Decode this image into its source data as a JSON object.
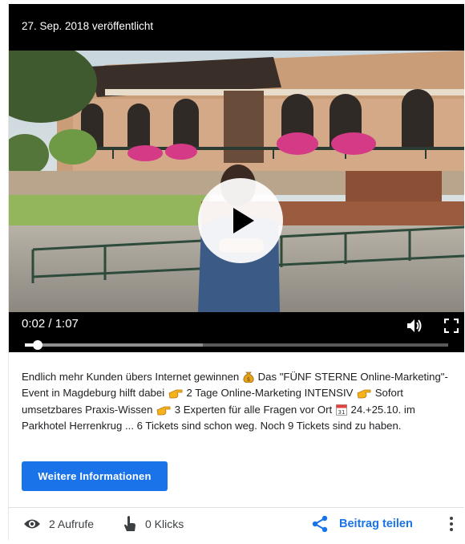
{
  "post": {
    "published_date": "27. Sep. 2018 veröffentlicht",
    "description_parts": {
      "p1": "Endlich mehr Kunden übers Internet gewinnen",
      "p2": "Das \"FÜNF STERNE Online-Marketing\"-Event in Magdeburg hilft dabei",
      "p3": "2 Tage Online-Marketing INTENSIV",
      "p4": "Sofort umsetzbares Praxis-Wissen",
      "p5": "3 Experten für alle Fragen vor Ort",
      "p6": "24.+25.10. im Parkhotel Herrenkrug ... 6 Tickets sind schon weg. Noch 9 Tickets sind zu haben."
    },
    "emoji_icons": [
      "money-bag-icon",
      "pointing-hand-icon",
      "pointing-hand-icon",
      "calendar-icon"
    ]
  },
  "video": {
    "time_display": "0:02 / 1:07",
    "progress_fraction": 0.03,
    "buffered_fraction": 0.42,
    "icons": [
      "play-icon",
      "volume-icon",
      "fullscreen-icon"
    ]
  },
  "actions": {
    "more_info_label": "Weitere Informationen"
  },
  "footer": {
    "views": "2 Aufrufe",
    "clicks": "0 Klicks",
    "share_label": "Beitrag teilen",
    "icons": [
      "eye-icon",
      "click-hand-icon",
      "share-icon",
      "more-vert-icon"
    ]
  },
  "colors": {
    "accent": "#1a73e8",
    "text": "#202124",
    "video_bg": "#000000"
  }
}
